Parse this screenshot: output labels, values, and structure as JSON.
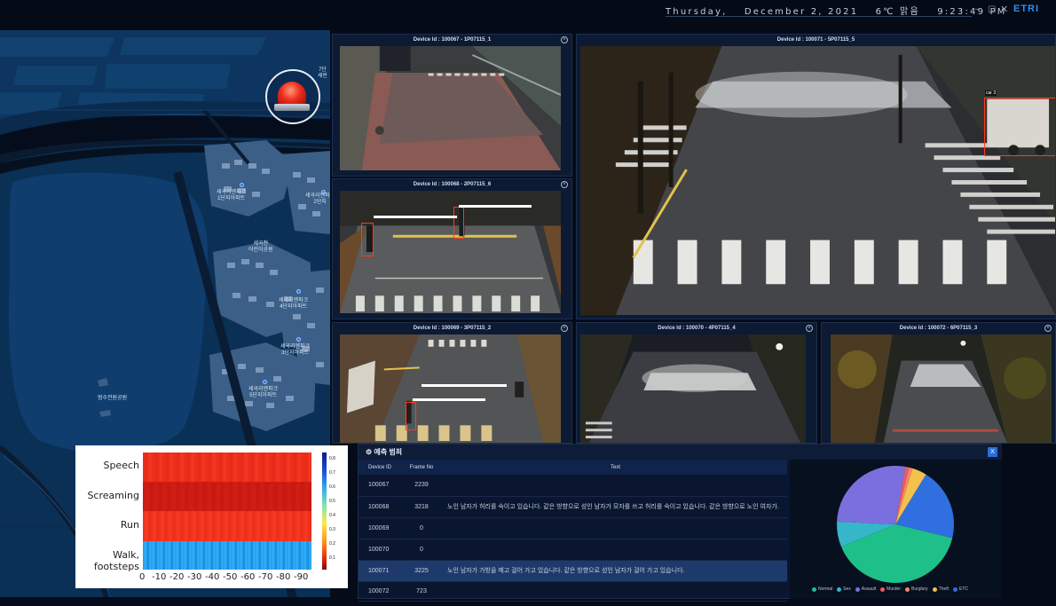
{
  "topbar": {
    "day": "Thursday,",
    "date": "December 2, 2021",
    "weather": "6℃ 맑음",
    "time": "9:23:49 PM",
    "logo": "ETRI",
    "minimize_icon": "minimize-icon",
    "restore_icon": "restore-icon",
    "close_icon": "close-icon"
  },
  "map": {
    "labels": [
      {
        "text": "세곡리엔파크\n1단지아파트"
      },
      {
        "text": "세곡리엔파크\n2단지"
      },
      {
        "text": "세곡천\n어린이공원"
      },
      {
        "text": "세곡리엔파크\n4단지아파트"
      },
      {
        "text": "세곡리엔파크\n3단지아파트"
      },
      {
        "text": "세곡리엔파크\n5단지아파트"
      },
      {
        "text": "범수전원공원"
      },
      {
        "text": "7단\n세란"
      }
    ],
    "siren_icon": "siren-icon"
  },
  "cameras": [
    {
      "title": "Device Id : 100067 - 1P07115_1"
    },
    {
      "title": "Device Id : 100068 - 2P07115_6"
    },
    {
      "title": "Device Id : 100069 - 3P07115_2"
    },
    {
      "title": "Device Id : 100070 - 4P07115_4"
    },
    {
      "title": "Device Id : 100072 - 6P07115_3"
    },
    {
      "title": "Device Id : 100071 - 5P07115_5"
    }
  ],
  "detections": {
    "car_tag": "car 3"
  },
  "spectrogram": {
    "rows": [
      "Speech",
      "Screaming",
      "Run",
      "Walk, footsteps"
    ],
    "x_ticks": [
      "0",
      "-10",
      "-20",
      "-30",
      "-40",
      "-50",
      "-60",
      "-70",
      "-80",
      "-90"
    ],
    "colorbar_ticks": [
      "0.8",
      "0.7",
      "0.6",
      "0.5",
      "0.4",
      "0.3",
      "0.2",
      "0.1"
    ]
  },
  "prediction": {
    "title": "예측 범죄",
    "close_label": "X",
    "columns": {
      "id": "Device ID",
      "frame": "Frame No",
      "text": "Text"
    },
    "rows": [
      {
        "id": "100067",
        "frame": "2239",
        "text": ""
      },
      {
        "id": "100068",
        "frame": "3218",
        "text": "노인 남자가 허리를 숙이고 있습니다. 같은 방향으로 성인 남자가 모자를 쓰고 허리를 숙이고 있습니다. 같은 방향으로 노인 여자가."
      },
      {
        "id": "100069",
        "frame": "0",
        "text": ""
      },
      {
        "id": "100070",
        "frame": "0",
        "text": ""
      },
      {
        "id": "100071",
        "frame": "3225",
        "text": "노인 남자가 가방을 메고 걸어 가고 있습니다. 같은 방향으로 성인 남자가 걸어 가고 있습니다."
      },
      {
        "id": "100072",
        "frame": "723",
        "text": ""
      }
    ]
  },
  "chart_data": {
    "type": "pie",
    "categories": [
      "Normal",
      "Sex",
      "Assault",
      "Murder",
      "Burglary",
      "Theft",
      "ETC"
    ],
    "values": [
      40,
      7,
      27,
      1,
      1,
      4,
      20
    ],
    "colors": [
      "#1fbf8a",
      "#35b7c9",
      "#7b6fe0",
      "#ef5b5b",
      "#f08a6a",
      "#f4c04e",
      "#2f6fe0"
    ],
    "legend_position": "bottom"
  }
}
